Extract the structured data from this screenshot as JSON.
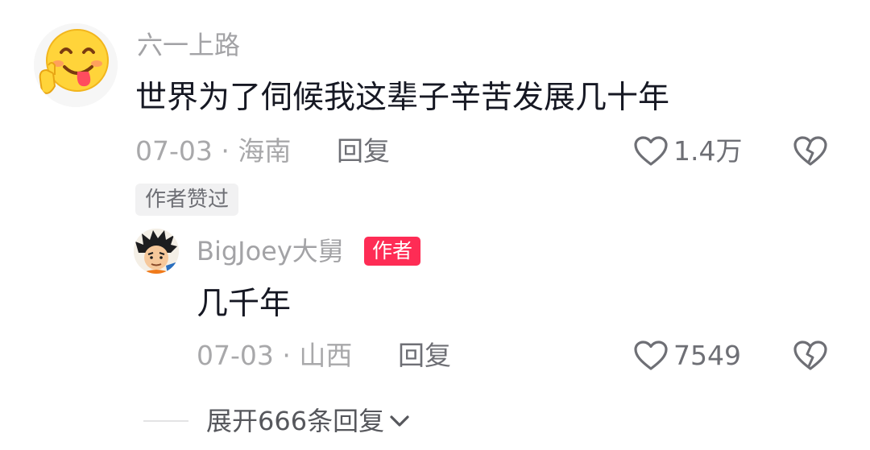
{
  "comment": {
    "username": "六一上路",
    "text": "世界为了伺候我这辈子辛苦发展几十年",
    "date_location": "07-03 · 海南",
    "reply_label": "回复",
    "like_count": "1.4万",
    "badge": "作者赞过",
    "avatar_icon": "smiley-tongue-thumbs-up-emoji",
    "like_icon": "heart-outline-icon",
    "dislike_icon": "broken-heart-icon"
  },
  "reply": {
    "username": "BigJoey大舅",
    "author_tag": "作者",
    "text": "几千年",
    "date_location": "07-03 · 山西",
    "reply_label": "回复",
    "like_count": "7549",
    "avatar_icon": "cartoon-character-avatar",
    "like_icon": "heart-outline-icon",
    "dislike_icon": "broken-heart-icon"
  },
  "expand": {
    "label": "展开666条回复",
    "icon": "chevron-down-icon"
  },
  "colors": {
    "text_primary": "#161823",
    "text_secondary": "#a8a8aa",
    "text_action": "#6e6f75",
    "author_tag_bg": "#fe2c55",
    "badge_bg": "#f1f1f2"
  }
}
